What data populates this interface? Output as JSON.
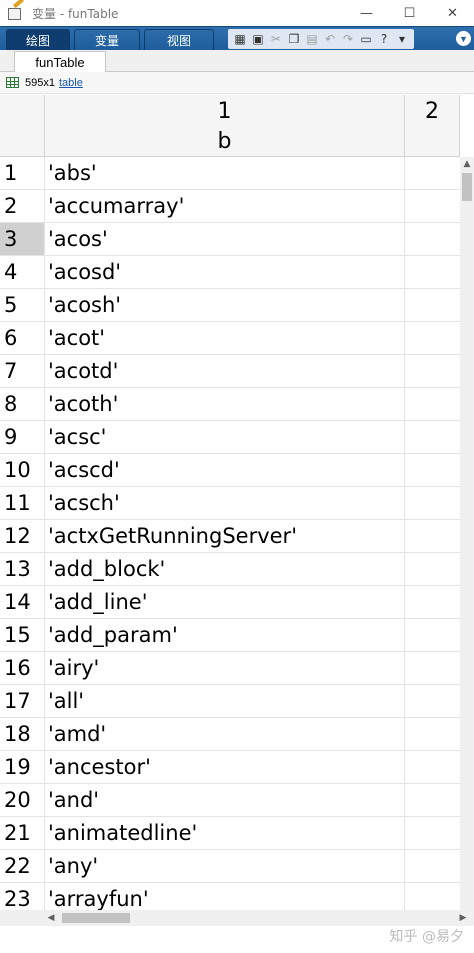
{
  "window": {
    "title": "变量 - funTable",
    "controls": [
      "—",
      "☐",
      "✕"
    ]
  },
  "toolstrip": {
    "tabs": [
      {
        "label": "绘图",
        "active": true
      },
      {
        "label": "变量",
        "active": false
      },
      {
        "label": "视图",
        "active": false
      }
    ],
    "quick_access_icons": [
      "new-variable-icon",
      "save-icon",
      "cut-icon",
      "copy-icon",
      "paste-icon",
      "undo-icon",
      "redo-icon",
      "switch-windows-icon",
      "help-icon",
      "more-icon"
    ],
    "collapse_icon": "chevron-down-icon"
  },
  "doc_tab": {
    "label": "funTable"
  },
  "variable_info": {
    "dimensions": "595x1",
    "class_name": "table"
  },
  "table": {
    "columns": [
      {
        "number": "1",
        "name": "b"
      },
      {
        "number": "2",
        "name": ""
      }
    ],
    "selected_row": "3",
    "rows": [
      {
        "n": "1",
        "value": "'abs'"
      },
      {
        "n": "2",
        "value": "'accumarray'"
      },
      {
        "n": "3",
        "value": "'acos'"
      },
      {
        "n": "4",
        "value": "'acosd'"
      },
      {
        "n": "5",
        "value": "'acosh'"
      },
      {
        "n": "6",
        "value": "'acot'"
      },
      {
        "n": "7",
        "value": "'acotd'"
      },
      {
        "n": "8",
        "value": "'acoth'"
      },
      {
        "n": "9",
        "value": "'acsc'"
      },
      {
        "n": "10",
        "value": "'acscd'"
      },
      {
        "n": "11",
        "value": "'acsch'"
      },
      {
        "n": "12",
        "value": "'actxGetRunningServer'"
      },
      {
        "n": "13",
        "value": "'add_block'"
      },
      {
        "n": "14",
        "value": "'add_line'"
      },
      {
        "n": "15",
        "value": "'add_param'"
      },
      {
        "n": "16",
        "value": "'airy'"
      },
      {
        "n": "17",
        "value": "'all'"
      },
      {
        "n": "18",
        "value": "'amd'"
      },
      {
        "n": "19",
        "value": "'ancestor'"
      },
      {
        "n": "20",
        "value": "'and'"
      },
      {
        "n": "21",
        "value": "'animatedline'"
      },
      {
        "n": "22",
        "value": "'any'"
      },
      {
        "n": "23",
        "value": "'arrayfun'"
      }
    ]
  },
  "watermark": "知乎 @易夕"
}
